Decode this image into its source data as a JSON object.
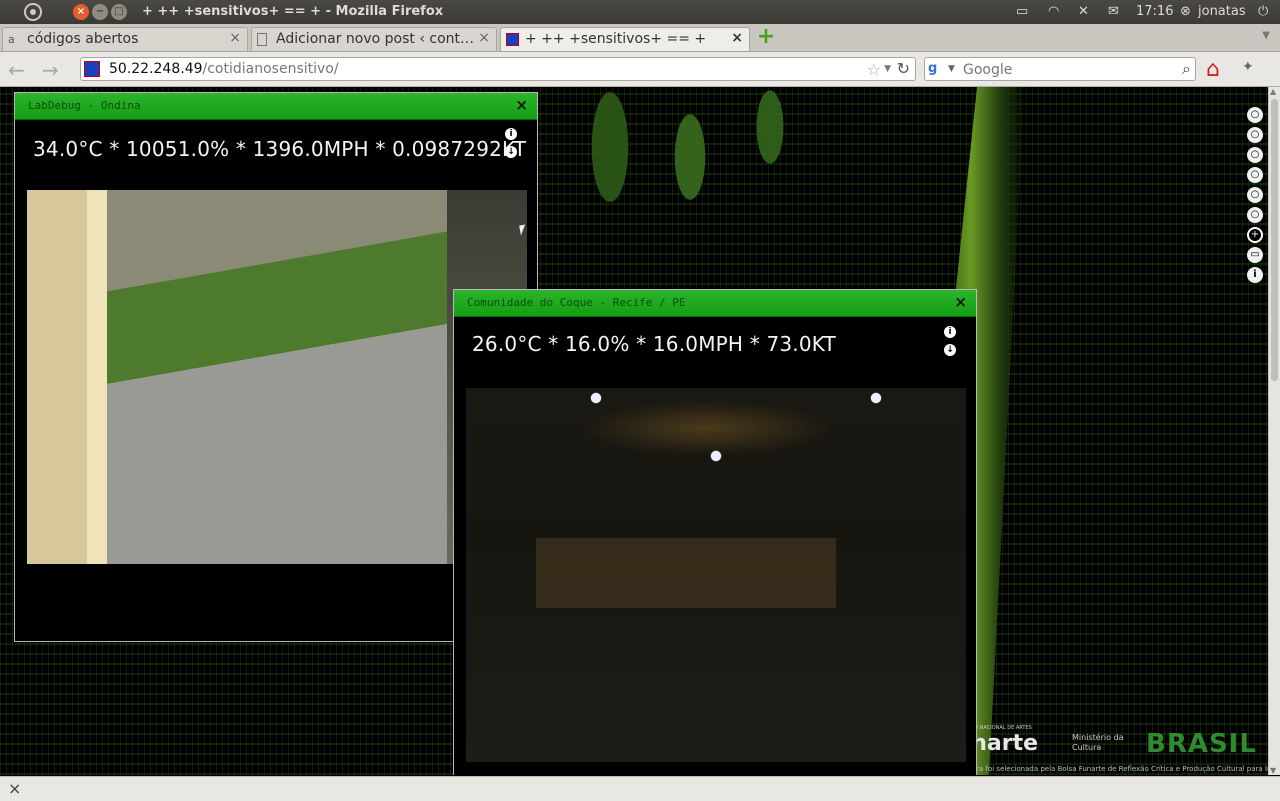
{
  "window": {
    "title": "+ ++ +sensitivos+ == + - Mozilla Firefox"
  },
  "tray": {
    "time": "17:16",
    "user": "jonatas"
  },
  "tabs": [
    {
      "label": "códigos abertos",
      "active": false
    },
    {
      "label": "Adicionar novo post ‹ contr…",
      "active": false
    },
    {
      "label": "+ ++ +sensitivos+ == +",
      "active": true
    }
  ],
  "navbar": {
    "url_host": "50.22.248.49",
    "url_path": "/cotidianosensitivo/",
    "search_placeholder": "Google"
  },
  "panels": [
    {
      "title": "LabDebug - Ondina",
      "readout": "34.0°C * 10051.0% * 1396.0MPH * 0.0987292KT"
    },
    {
      "title": "Comunidade do Coque - Recife / PE",
      "readout": "26.0°C * 16.0% * 16.0MPH * 73.0KT"
    }
  ],
  "logos": {
    "funarte_header": "FUNDAÇÃO NACIONAL DE ARTES",
    "funarte": "funarte",
    "ministry": "Ministério da Cultura",
    "brasil": "BRASIL",
    "credit": "Esta obra foi selecionada pela Bolsa Funarte de Reflexão Crítica e Produção Cultural para Internet"
  },
  "colors": {
    "panel_header": "#1fa81f",
    "page_bg": "#000000"
  },
  "icons": {
    "sidebar": [
      "lightbulb-icon",
      "lightbulb-icon",
      "lightbulb-icon",
      "lightbulb-icon",
      "lightbulb-icon",
      "lightbulb-icon",
      "plus-circle-icon",
      "comment-icon",
      "info-icon"
    ]
  }
}
